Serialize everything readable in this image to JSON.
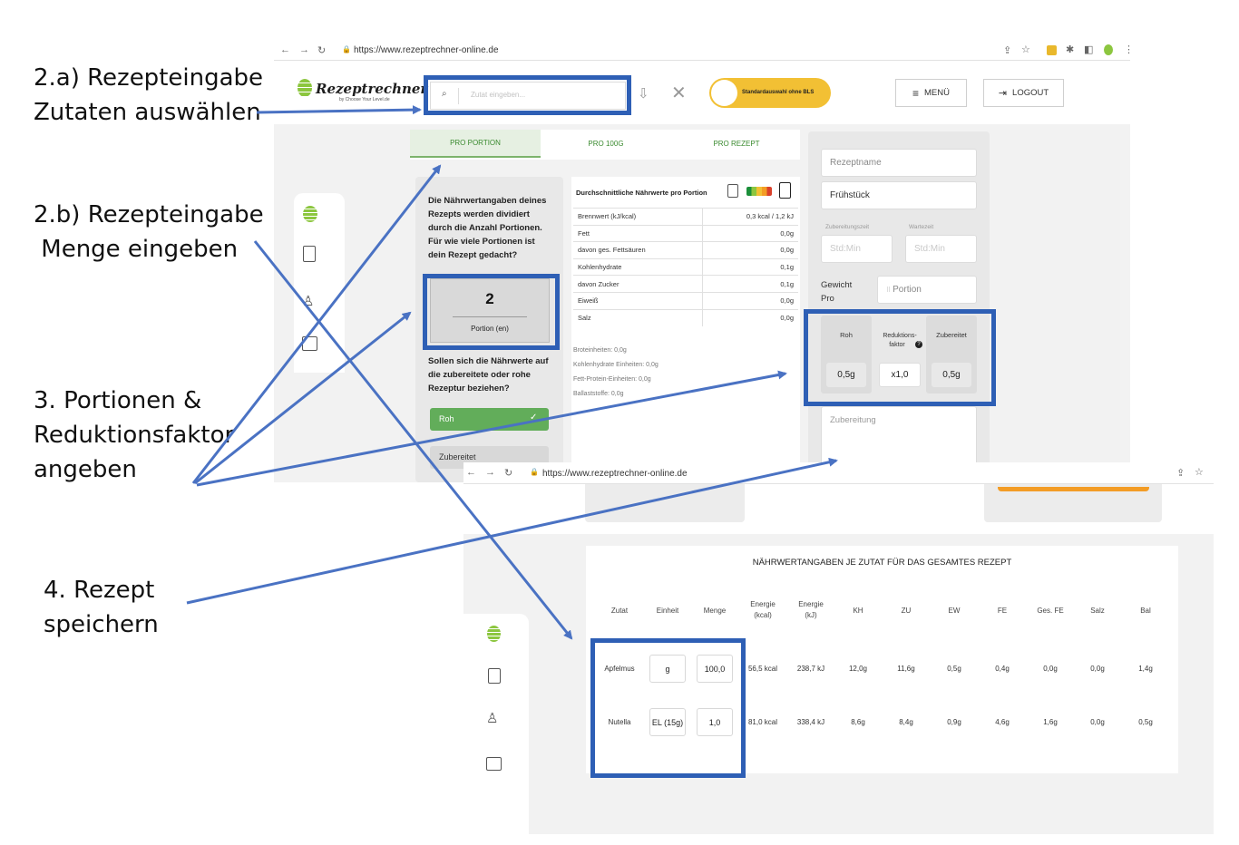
{
  "annotations": {
    "step_2a_line1": "2.a) Rezepteingabe",
    "step_2a_line2": "Zutaten auswählen",
    "step_2b_line1": "2.b) Rezepteingabe",
    "step_2b_line2": " Menge eingeben",
    "step_3_line1": "3. Portionen &",
    "step_3_line2": "Reduktionsfaktor",
    "step_3_line3": "angeben",
    "step_4_line1": "4. Rezept",
    "step_4_line2": "speichern"
  },
  "browser": {
    "url": "https://www.rezeptrechner-online.de"
  },
  "header": {
    "logo_text": "Rezeptrechner",
    "logo_sub": "by Choose Your Level.de",
    "search_placeholder": "Zutat eingeben...",
    "toggle_label": "Standardauswahl ohne BLS",
    "menu_label": "MENÜ",
    "logout_label": "LOGOUT"
  },
  "tabs": [
    "PRO PORTION",
    "PRO 100G",
    "PRO REZEPT"
  ],
  "portion_panel": {
    "info_text": "Die Nährwertangaben deines Rezepts werden dividiert durch die Anzahl Portionen. Für wie viele Portionen ist dein Rezept gedacht?",
    "portion_value": "2",
    "portion_unit": "Portion (en)",
    "question": "Sollen sich die Nährwerte auf die zubereitete oder rohe Rezeptur beziehen?",
    "option_raw": "Roh",
    "option_cooked": "Zubereitet"
  },
  "nutrition": {
    "title": "Durchschnittliche Nährwerte pro Portion",
    "rows": [
      {
        "label": "Brennwert (kJ/kcal)",
        "value": "0,3 kcal / 1,2 kJ"
      },
      {
        "label": "Fett",
        "value": "0,0g"
      },
      {
        "label": "davon ges. Fettsäuren",
        "value": "0,0g"
      },
      {
        "label": "Kohlenhydrate",
        "value": "0,1g"
      },
      {
        "label": "davon Zucker",
        "value": "0,1g"
      },
      {
        "label": "Eiweiß",
        "value": "0,0g"
      },
      {
        "label": "Salz",
        "value": "0,0g"
      }
    ],
    "extra": [
      "Broteinheiten: 0,0g",
      "Kohlenhydrate Einheiten: 0,0g",
      "Fett-Protein-Einheiten: 0,0g",
      "Ballaststoffe: 0,0g"
    ]
  },
  "recipe_form": {
    "name_placeholder": "Rezeptname",
    "category_value": "Frühstück",
    "prep_time_label": "Zubereitungszeit",
    "wait_time_label": "Wartezeit",
    "time_placeholder": "Std:Min",
    "weight_label_1": "Gewicht",
    "weight_label_2": "Pro",
    "weight_unit": "Portion",
    "raw_label": "Roh",
    "reduction_label_1": "Reduktions-",
    "reduction_label_2": "faktor",
    "cooked_label": "Zubereitet",
    "raw_value": "0,5g",
    "reduction_value": "x1,0",
    "cooked_value": "0,5g",
    "preparation_placeholder": "Zubereitung"
  },
  "ingredients_table": {
    "title": "NÄHRWERTANGABEN JE ZUTAT FÜR DAS GESAMTES REZEPT",
    "headers": [
      "Zutat",
      "Einheit",
      "Menge",
      "Energie\n(kcal)",
      "Energie\n(kJ)",
      "KH",
      "ZU",
      "EW",
      "FE",
      "Ges. FE",
      "Salz",
      "Bal"
    ],
    "rows": [
      [
        "Apfelmus",
        "g",
        "100,0",
        "56,5 kcal",
        "238,7 kJ",
        "12,0g",
        "11,6g",
        "0,5g",
        "0,4g",
        "0,0g",
        "0,0g",
        "1,4g"
      ],
      [
        "Nutella",
        "EL (15g)",
        "1,0",
        "81,0 kcal",
        "338,4 kJ",
        "8,6g",
        "8,4g",
        "0,9g",
        "4,6g",
        "1,6g",
        "0,0g",
        "0,5g"
      ]
    ]
  },
  "colors": {
    "annotation_blue": "#2e5fb5",
    "brand_green": "#3a8a2f",
    "toggle_yellow": "#f2c034",
    "save_orange": "#f39c25"
  }
}
